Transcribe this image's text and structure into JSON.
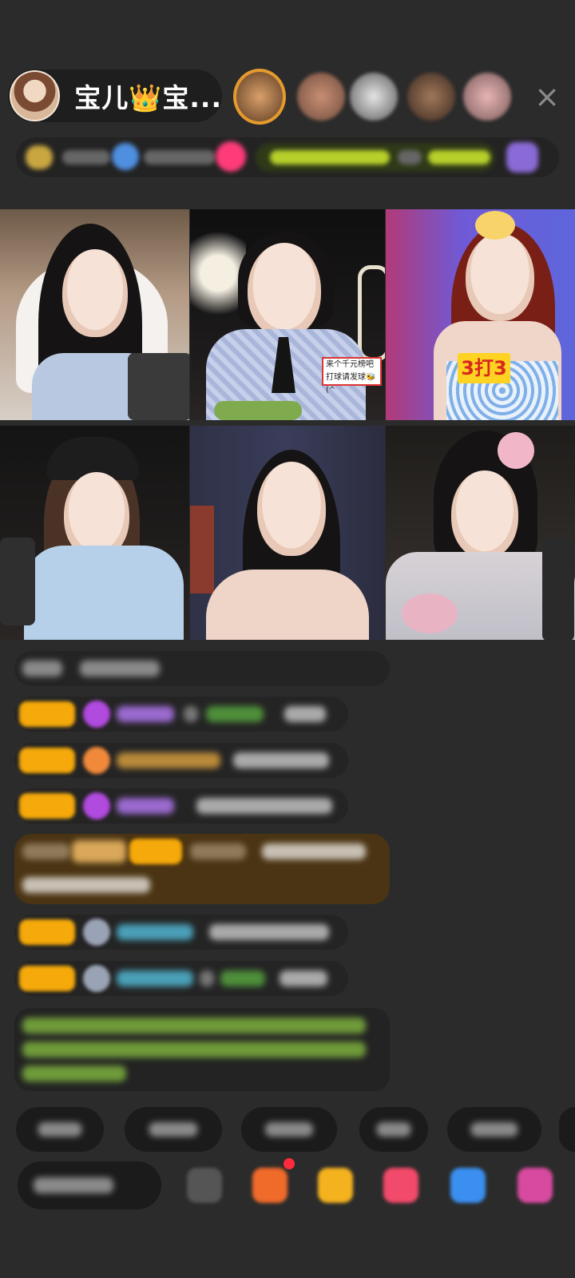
{
  "header": {
    "host_name": "宝儿👑宝...",
    "close_icon": "×"
  },
  "grid": {
    "tile3_label": "3打3",
    "tile2_sign_line1": "来个千元榜吧",
    "tile2_sign_line2": "打球请发球🐝(^"
  }
}
